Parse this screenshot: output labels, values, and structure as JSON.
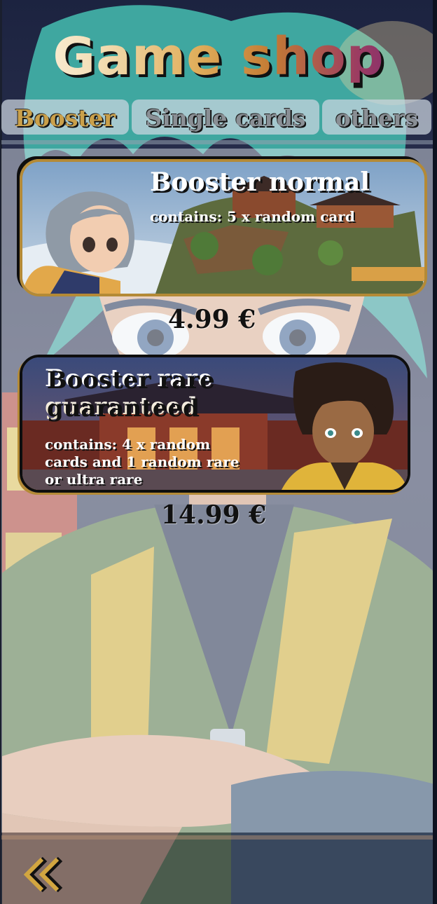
{
  "header": {
    "title": "Game shop"
  },
  "tabs": [
    {
      "label": "Booster",
      "active": true
    },
    {
      "label": "Single cards",
      "active": false
    },
    {
      "label": "others",
      "active": false
    }
  ],
  "products": [
    {
      "title": "Booster normal",
      "description": "contains: 5 x random card",
      "price": "4.99 €"
    },
    {
      "title": "Booster rare guaranteed",
      "description": "contains: 4 x random cards and 1 random rare or ultra rare",
      "price": "14.99 €"
    }
  ],
  "footer": {
    "back_icon": "double-chevron-left-icon"
  },
  "colors": {
    "accent_gold": "#b48a36",
    "tab_active": "#caa04a",
    "title_gradient_end": "#6e1f78"
  }
}
